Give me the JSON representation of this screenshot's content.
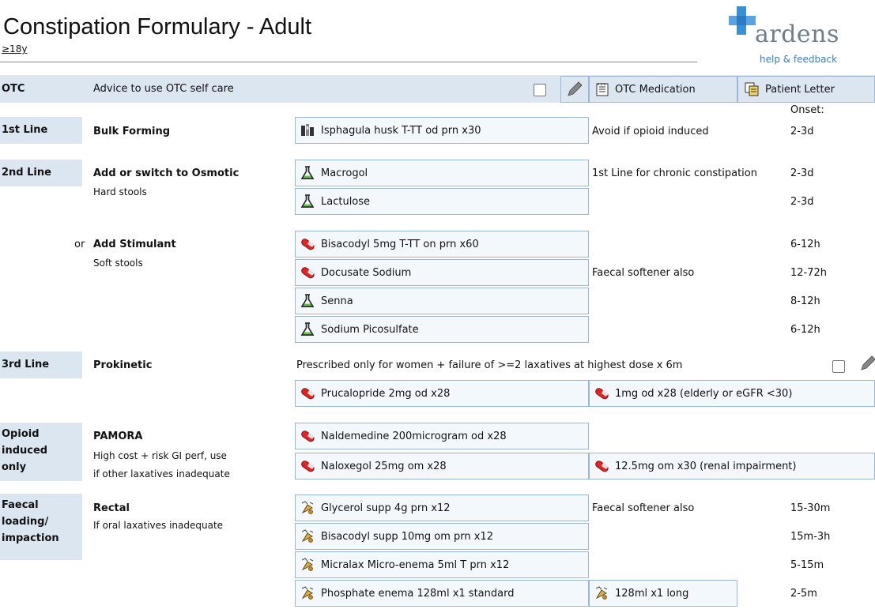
{
  "header": {
    "title": "Constipation Formulary - Adult",
    "age_restriction": "≥18y",
    "logo_text": "ardens",
    "help_link": "help & feedback"
  },
  "otc": {
    "label": "OTC",
    "advice": "Advice to use OTC self care",
    "otc_med_button": "OTC Medication",
    "patient_letter_button": "Patient Letter"
  },
  "onset_label": "Onset:",
  "first_line": {
    "label": "1st Line",
    "heading": "Bulk Forming",
    "items": [
      {
        "name": "Isphagula husk T-TT od prn x30",
        "icon": "sachet-icon"
      }
    ],
    "note": "Avoid if opioid induced",
    "onset": [
      "2-3d"
    ]
  },
  "second_line": {
    "label": "2nd Line",
    "osmotic": {
      "heading": "Add or switch to Osmotic",
      "sub": "Hard stools",
      "items": [
        {
          "name": "Macrogol",
          "icon": "flask-icon",
          "note": "1st Line for chronic constipation",
          "onset": "2-3d"
        },
        {
          "name": "Lactulose",
          "icon": "flask-icon",
          "note": "",
          "onset": "2-3d"
        }
      ]
    },
    "stimulant": {
      "prefix": "or",
      "heading": "Add Stimulant",
      "sub": "Soft stools",
      "items": [
        {
          "name": "Bisacodyl 5mg T-TT on prn x60",
          "icon": "capsule-icon",
          "note": "",
          "onset": "6-12h"
        },
        {
          "name": "Docusate Sodium",
          "icon": "capsule-icon",
          "note": "Faecal softener also",
          "onset": "12-72h"
        },
        {
          "name": "Senna",
          "icon": "flask-icon",
          "note": "",
          "onset": "8-12h"
        },
        {
          "name": "Sodium Picosulfate",
          "icon": "flask-icon",
          "note": "",
          "onset": "6-12h"
        }
      ]
    }
  },
  "third_line": {
    "label": "3rd Line",
    "heading": "Prokinetic",
    "note": "Prescribed only for women + failure of >=2 laxatives at highest dose x 6m",
    "item": "Prucalopride 2mg od x28",
    "alt_item": "1mg od x28 (elderly or eGFR <30)"
  },
  "opioid": {
    "label_lines": [
      "Opioid",
      "induced",
      "only"
    ],
    "heading": "PAMORA",
    "sub_lines": [
      "High cost + risk GI perf, use",
      "if other laxatives inadequate"
    ],
    "items": [
      "Naldemedine 200microgram od x28",
      "Naloxegol 25mg om x28"
    ],
    "alt_item": "12.5mg om x30 (renal impairment)"
  },
  "faecal": {
    "label_lines": [
      "Faecal",
      "loading/",
      "impaction"
    ],
    "heading": "Rectal",
    "sub": "If oral laxatives inadequate",
    "items": [
      {
        "name": "Glycerol supp 4g prn x12",
        "note": "Faecal softener also",
        "onset": "15-30m"
      },
      {
        "name": "Bisacodyl supp 10mg om prn x12",
        "note": "",
        "onset": "15m-3h"
      },
      {
        "name": "Micralax Micro-enema 5ml T prn x12",
        "note": "",
        "onset": "5-15m"
      },
      {
        "name": "Phosphate enema 128ml x1 standard",
        "note": "",
        "onset": "2-5m"
      }
    ],
    "alt_item": "128ml x1 long"
  },
  "colors": {
    "category_bg": "#dce6f1",
    "box_border": "#9bb5d4",
    "box_bg": "#f3f8fd",
    "logo_blue": "#3a8fd6",
    "help_link": "#3a7cc4"
  }
}
